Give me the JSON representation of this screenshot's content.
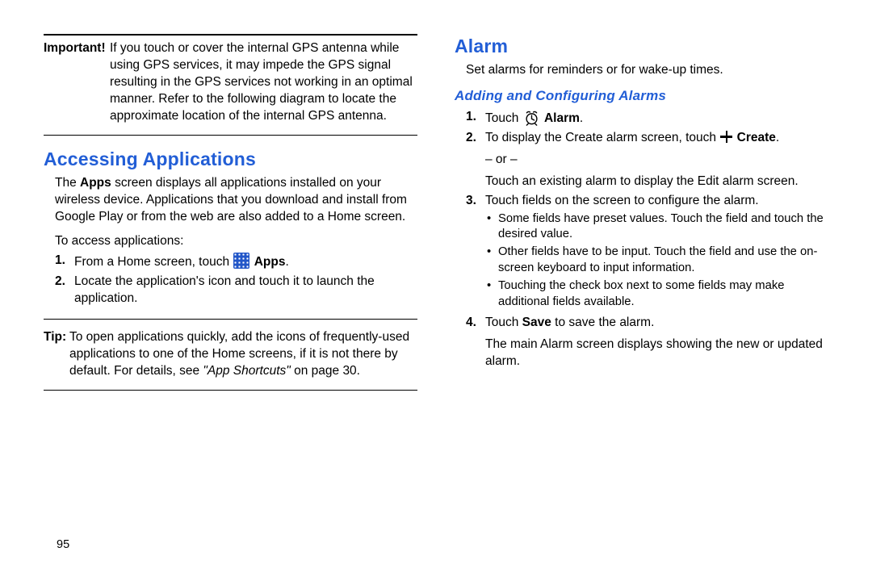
{
  "left": {
    "important_label": "Important!",
    "important_body_1": "If you touch or cover the internal GPS antenna while using GPS services, it may impede the GPS signal resulting in the GPS services not working in an optimal manner. Refer to the following diagram to locate the approximate location of the internal GPS antenna.",
    "heading_apps": "Accessing Applications",
    "apps_para": "The Apps screen displays all applications installed on your wireless device. Applications that you download and install from Google Play or from the web are also added to a Home screen.",
    "apps_para_bold": "Apps",
    "apps_access": "To access applications:",
    "apps_step1_a": "From a Home screen, touch ",
    "apps_step1_b": "Apps",
    "apps_step1_c": ".",
    "apps_step2": "Locate the application's icon and touch it to launch the application.",
    "tip_label": "Tip:",
    "tip_body_a": "To open applications quickly, add the icons of frequently-used applications to one of the Home screens, if it is not there by default. For details, see ",
    "tip_body_link": "\"App Shortcuts\"",
    "tip_body_b": " on page 30."
  },
  "right": {
    "heading_alarm": "Alarm",
    "alarm_intro": "Set alarms for reminders or for wake-up times.",
    "subheading": "Adding and Configuring Alarms",
    "s1_a": "Touch ",
    "s1_b": "Alarm",
    "s1_c": ".",
    "s2_a": "To display the Create alarm screen, touch ",
    "s2_b": "Create",
    "s2_c": ".",
    "s2_or": "– or –",
    "s2_alt": "Touch an existing alarm to display the Edit alarm screen.",
    "s3": "Touch fields on the screen to configure the alarm.",
    "s3_b1": "Some fields have preset values. Touch the field and touch the desired value.",
    "s3_b2": "Other fields have to be input. Touch the field and use the on-screen keyboard to input information.",
    "s3_b3": "Touching the check box next to some fields may make additional fields available.",
    "s4_a": "Touch ",
    "s4_b": "Save",
    "s4_c": " to save the alarm.",
    "s4_p": "The main Alarm screen displays showing the new or updated alarm."
  },
  "page_number": "95",
  "list_numbers": {
    "n1": "1.",
    "n2": "2.",
    "n3": "3.",
    "n4": "4."
  },
  "bullet": "•"
}
